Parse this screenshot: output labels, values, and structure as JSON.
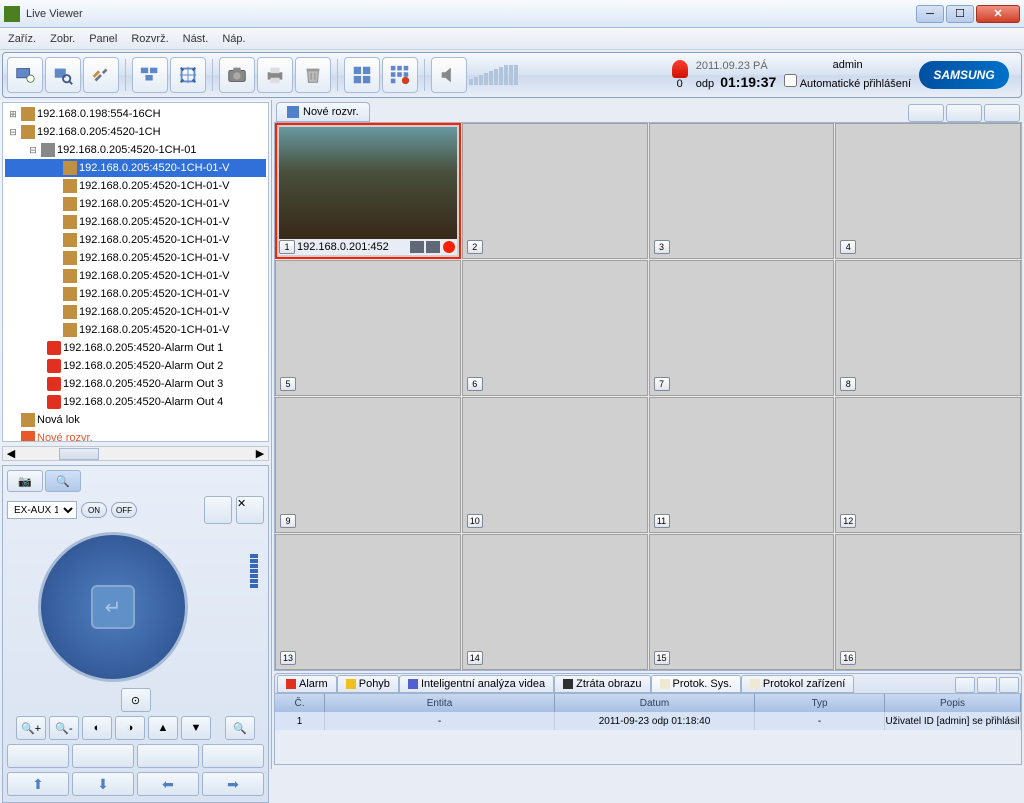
{
  "window": {
    "title": "Live Viewer"
  },
  "menu": [
    "Zaříz.",
    "Zobr.",
    "Panel",
    "Rozvrž.",
    "Nást.",
    "Náp."
  ],
  "toolbar": {
    "alarm_count": "0",
    "date": "2011.09.23 PÁ",
    "time_prefix": "odp",
    "time": "01:19:37",
    "admin": "admin",
    "autologin": "Automatické přihlášení",
    "logo": "SAMSUNG"
  },
  "tree": {
    "root1": "192.168.0.198:554-16CH",
    "root2": "192.168.0.205:4520-1CH",
    "sub1": "192.168.0.205:4520-1CH-01",
    "sel": "192.168.0.205:4520-1CH-01-V",
    "ch": [
      "192.168.0.205:4520-1CH-01-V",
      "192.168.0.205:4520-1CH-01-V",
      "192.168.0.205:4520-1CH-01-V",
      "192.168.0.205:4520-1CH-01-V",
      "192.168.0.205:4520-1CH-01-V",
      "192.168.0.205:4520-1CH-01-V",
      "192.168.0.205:4520-1CH-01-V",
      "192.168.0.205:4520-1CH-01-V",
      "192.168.0.205:4520-1CH-01-V"
    ],
    "alarms": [
      "192.168.0.205:4520-Alarm Out 1",
      "192.168.0.205:4520-Alarm Out 2",
      "192.168.0.205:4520-Alarm Out 3",
      "192.168.0.205:4520-Alarm Out 4"
    ],
    "novalok": "Nová lok",
    "novrozvr": "Nové rozvr."
  },
  "ptz": {
    "dropdown": "EX-AUX 1",
    "on": "ON",
    "off": "OFF"
  },
  "viewtab": "Nové rozvr.",
  "feed_ip": "192.168.0.201:452",
  "log_tabs": [
    "Alarm",
    "Pohyb",
    "Inteligentní analýza videa",
    "Ztráta obrazu",
    "Protok. Sys.",
    "Protokol zařízení"
  ],
  "log_headers": [
    "Č.",
    "Entita",
    "Datum",
    "Typ",
    "Popis"
  ],
  "log_row": {
    "n": "1",
    "entity": "-",
    "date": "2011-09-23 odp 01:18:40",
    "type": "-",
    "desc": "Uživatel ID [admin] se přihlásil"
  }
}
